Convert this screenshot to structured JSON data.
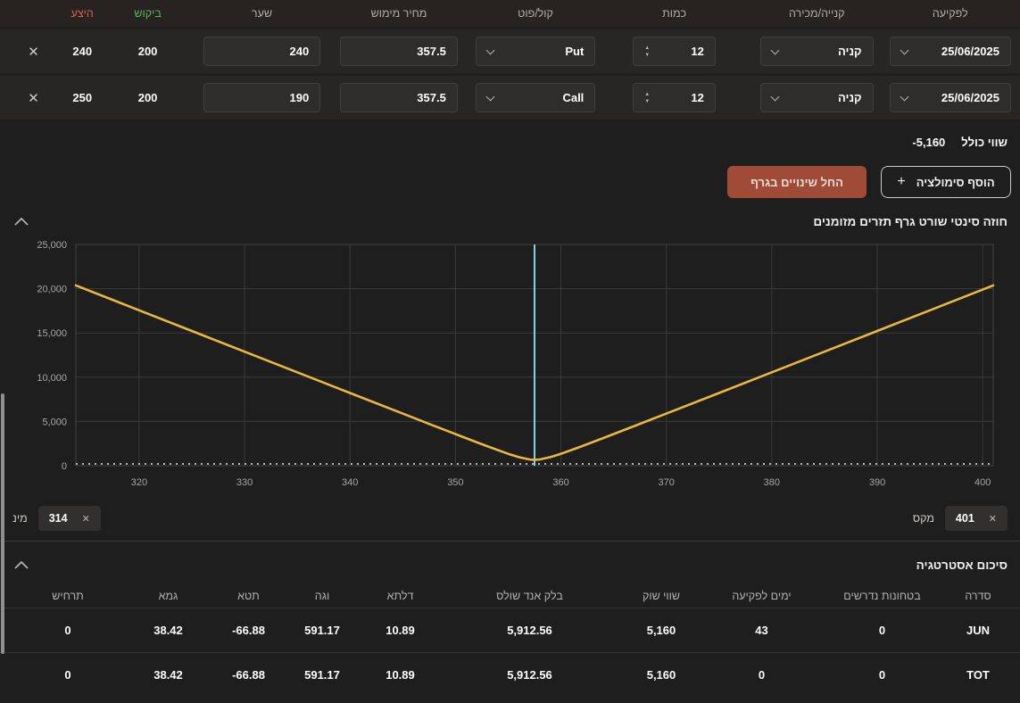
{
  "theme": {
    "accent_green": "#58b75c",
    "accent_red": "#e2604c",
    "curve_yellow": "#e7b83b",
    "marker_blue": "#86d0ee",
    "apply_button_bg": "#a04a38"
  },
  "legs_table": {
    "headers": {
      "expiry": "לפקיעה",
      "side": "קנייה/מכירה",
      "quantity": "כמות",
      "call_put": "קול/פוט",
      "strike": "מחיר מימוש",
      "rate": "שער",
      "bid": "ביקוש",
      "ask": "היצע"
    },
    "close_icon": "✕",
    "rows": [
      {
        "expiry": "25/06/2025",
        "side": "קניה",
        "quantity": "12",
        "call_put": "Put",
        "strike": "357.5",
        "rate": "240",
        "bid": "200",
        "ask": "240"
      },
      {
        "expiry": "25/06/2025",
        "side": "קניה",
        "quantity": "12",
        "call_put": "Call",
        "strike": "357.5",
        "rate": "190",
        "bid": "200",
        "ask": "250"
      }
    ]
  },
  "totals": {
    "label": "שווי כולל",
    "value": "-5,160"
  },
  "actions": {
    "add_simulation": "הוסף סימולציה",
    "plus_icon": "+",
    "apply_changes": "החל שינויים בגרף"
  },
  "chart_section": {
    "title": "חוזה סינטי שורט גרף תזרים מזומנים",
    "min_label": "מינ",
    "min_value": "314",
    "max_label": "מקס",
    "max_value": "401",
    "clear_icon": "✕"
  },
  "chart_data": {
    "type": "line",
    "title": "חוזה סינטי שורט גרף תזרים מזומנים",
    "x_range": [
      314,
      401
    ],
    "y_range": [
      0,
      25000
    ],
    "x_ticks": [
      320,
      330,
      340,
      350,
      360,
      370,
      380,
      390,
      400
    ],
    "y_ticks": [
      0,
      5000,
      10000,
      15000,
      20000,
      25000
    ],
    "grid": true,
    "marker_x": 357.5,
    "marker_color": "#86d0ee",
    "zero_line_y": 0,
    "series": [
      {
        "name": "תזרים מזומנים",
        "color": "#e7b83b",
        "points": [
          [
            314,
            20369
          ],
          [
            320,
            17563
          ],
          [
            325,
            15224
          ],
          [
            330,
            12887
          ],
          [
            335,
            10551
          ],
          [
            340,
            8217
          ],
          [
            345,
            5887
          ],
          [
            348,
            4495
          ],
          [
            351,
            3113
          ],
          [
            353,
            2208
          ],
          [
            355,
            1344
          ],
          [
            356,
            965
          ],
          [
            357,
            702
          ],
          [
            357.5,
            662
          ],
          [
            358,
            702
          ],
          [
            359,
            965
          ],
          [
            360,
            1344
          ],
          [
            362,
            2208
          ],
          [
            364,
            3113
          ],
          [
            367,
            4495
          ],
          [
            370,
            5887
          ],
          [
            375,
            8217
          ],
          [
            380,
            10551
          ],
          [
            385,
            12887
          ],
          [
            390,
            15224
          ],
          [
            395,
            17563
          ],
          [
            401,
            20369
          ]
        ]
      }
    ]
  },
  "strategy_summary": {
    "title": "סיכום אסטרטגיה",
    "headers": [
      "סדרה",
      "בטחונות נדרשים",
      "ימים לפקיעה",
      "שווי שוק",
      "בלק אנד שולס",
      "דלתא",
      "וגה",
      "תטא",
      "גמא",
      "תרחיש"
    ],
    "rows": [
      [
        "JUN",
        "0",
        "43",
        "5,160",
        "5,912.56",
        "10.89",
        "591.17",
        "-66.88",
        "38.42",
        "0"
      ],
      [
        "TOT",
        "0",
        "0",
        "5,160",
        "5,912.56",
        "10.89",
        "591.17",
        "-66.88",
        "38.42",
        "0"
      ]
    ]
  }
}
